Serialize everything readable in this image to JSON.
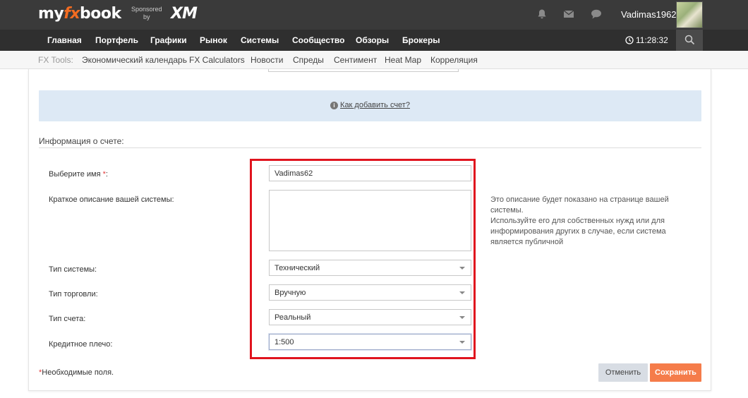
{
  "header": {
    "logo_my": "my",
    "logo_fx": "fx",
    "logo_book": "book",
    "sponsored_line1": "Sponsored",
    "sponsored_line2": "by",
    "sponsor_logo": "XM",
    "username": "Vadimas1962",
    "icons": [
      "bell-icon",
      "envelope-icon",
      "chat-icon"
    ]
  },
  "nav": {
    "items": [
      "Главная",
      "Портфель",
      "Графики",
      "Рынок",
      "Системы",
      "Сообщество",
      "Обзоры",
      "Брокеры"
    ],
    "time": "11:28:32"
  },
  "tools": {
    "label": "FX Tools:",
    "links": [
      "Экономический календарь",
      "FX Calculators",
      "Новости",
      "Спреды",
      "Сентимент",
      "Heat Map",
      "Корреляция"
    ]
  },
  "info_panel": {
    "link_text": "Как добавить счет?"
  },
  "section": {
    "title": "Информация о счете:"
  },
  "form": {
    "name_label": "Выберите имя",
    "name_required_mark": "*",
    "name_label_suffix": ":",
    "name_value": "Vadimas62",
    "description_label": "Краткое описание вашей системы:",
    "description_value": "",
    "description_help": "Это описание будет показано на странице вашей системы.\nИспользуйте его для собственных нужд или для информирования других в случае, если система является публичной",
    "system_type_label": "Тип системы:",
    "system_type_value": "Технический",
    "trading_type_label": "Тип торговли:",
    "trading_type_value": "Вручную",
    "account_type_label": "Тип счета:",
    "account_type_value": "Реальный",
    "leverage_label": "Кредитное плечо:",
    "leverage_value": "1:500"
  },
  "footer": {
    "required_mark": "*",
    "required_text": "Необходимые поля.",
    "cancel_label": "Отменить",
    "save_label": "Сохранить"
  },
  "colors": {
    "header_bg": "#3a3a3a",
    "nav_bg": "#2f2f2f",
    "info_bg": "#dde9f5",
    "highlight_border": "#e0141e",
    "save_button": "#f57c4a",
    "cancel_button": "#d8dde4"
  }
}
